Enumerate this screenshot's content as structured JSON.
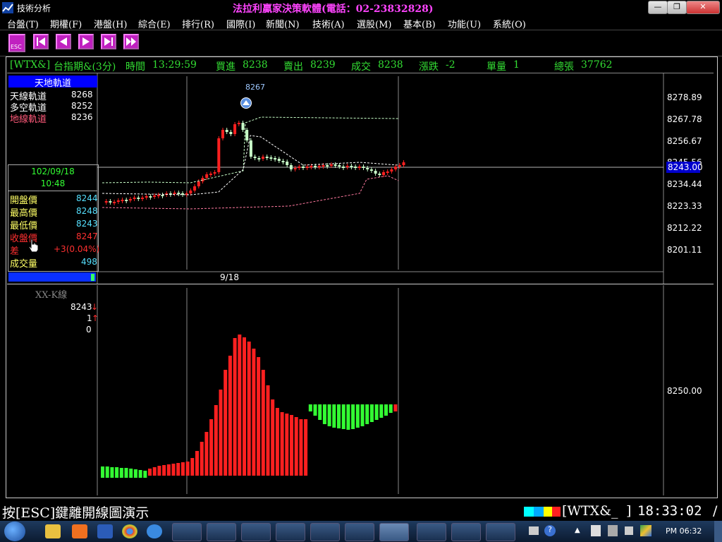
{
  "window": {
    "title": "技術分析",
    "center_title": "法拉利贏家決策軟體(電話：02-23832828)"
  },
  "menu": [
    "台盤(T)",
    "期權(F)",
    "港盤(H)",
    "綜合(E)",
    "排行(R)",
    "國際(I)",
    "新聞(N)",
    "技術(A)",
    "選股(M)",
    "基本(B)",
    "功能(U)",
    "系統(O)"
  ],
  "toolbar": {
    "esc_label": "ESC"
  },
  "quote": {
    "symbol": "[WTX&]",
    "name": "台指期&(3分)",
    "time_label": "時間",
    "time": "13:29:59",
    "bid_label": "買進",
    "bid": "8238",
    "ask_label": "賣出",
    "ask": "8239",
    "last_label": "成交",
    "last": "8238",
    "change_label": "漲跌",
    "change": "-2",
    "vol_label": "單量",
    "vol": "1",
    "total_label": "總張",
    "total": "37762"
  },
  "indicator_panel": {
    "title": "天地軌道",
    "rows": [
      {
        "label": "天線軌道",
        "value": "8268",
        "color": "#ffffff"
      },
      {
        "label": "多空軌道",
        "value": "8252",
        "color": "#ffffff"
      },
      {
        "label": "地線軌道",
        "value": "8236",
        "color": "#ff5a7a"
      }
    ]
  },
  "bar_info": {
    "date": "102/09/18",
    "time": "10:48",
    "rows": [
      {
        "label": "開盤價",
        "value": "8244",
        "lcolor": "#ffff66",
        "vcolor": "#55e0ff"
      },
      {
        "label": "最高價",
        "value": "8248",
        "lcolor": "#ffff66",
        "vcolor": "#55e0ff"
      },
      {
        "label": "最低價",
        "value": "8243",
        "lcolor": "#ffff66",
        "vcolor": "#55e0ff"
      },
      {
        "label": "收盤價",
        "value": "8247",
        "lcolor": "#ff3030",
        "vcolor": "#ff3030"
      },
      {
        "label": "差",
        "value": "+3(0.04%)",
        "lcolor": "#ff3030",
        "vcolor": "#ff3030"
      },
      {
        "label": "成交量",
        "value": "498",
        "lcolor": "#ffff66",
        "vcolor": "#55e0ff"
      }
    ]
  },
  "upper_chart": {
    "y_ticks": [
      "8278.89",
      "8267.78",
      "8256.67",
      "8245.56",
      "8234.44",
      "8223.33",
      "8212.22",
      "8201.11"
    ],
    "current_price_label": "8243.00",
    "peak_label": "8267",
    "date_label": "9/18"
  },
  "lower_chart": {
    "title": "XX-K線",
    "values": [
      "8243",
      "1",
      "0"
    ],
    "arrow": "↓",
    "arrow2": "↑",
    "y_tick": "8250.00"
  },
  "status": {
    "message": "按[ESC]鍵離開線圖演示",
    "symbol": "[WTX&_",
    "bracket": "]",
    "clock": "18:33:02",
    "end": "/"
  },
  "taskbar": {
    "clock": "PM 06:32"
  },
  "colors": {
    "up": "#ff2020",
    "down": "#33ff33",
    "header_green": "#33dd33",
    "label_yellow": "#ffff66",
    "cyan": "#55e0ff"
  }
}
